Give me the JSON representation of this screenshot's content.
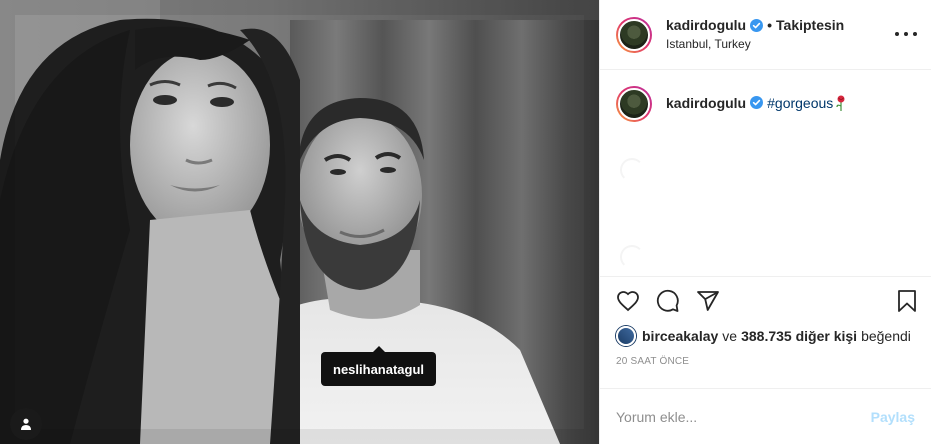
{
  "post": {
    "author": {
      "username": "kadirdogulu",
      "follow_status": "Takiptesin",
      "location": "Istanbul, Turkey",
      "verified": true
    },
    "caption": {
      "username": "kadirdogulu",
      "hashtag": "#gorgeous",
      "emoji": "rose-emoji"
    },
    "photo_tag": "neslihanatagul",
    "likes": {
      "first_user": "birceakalay",
      "connector": "ve",
      "others": "388.735 diğer kişi",
      "suffix": "beğendi"
    },
    "time_ago": "20 SAAT ÖNCE",
    "comment": {
      "placeholder": "Yorum ekle...",
      "post_label": "Paylaş"
    }
  },
  "icons": {
    "like": "heart-icon",
    "comment": "comment-bubble-icon",
    "share": "paper-plane-icon",
    "save": "bookmark-icon",
    "options": "more-options-icon",
    "tagged_user": "user-tag-icon"
  },
  "colors": {
    "link": "#00376b",
    "verified": "#3897f0",
    "muted": "#8e8e8e",
    "post_button_disabled": "#b2dffc"
  }
}
